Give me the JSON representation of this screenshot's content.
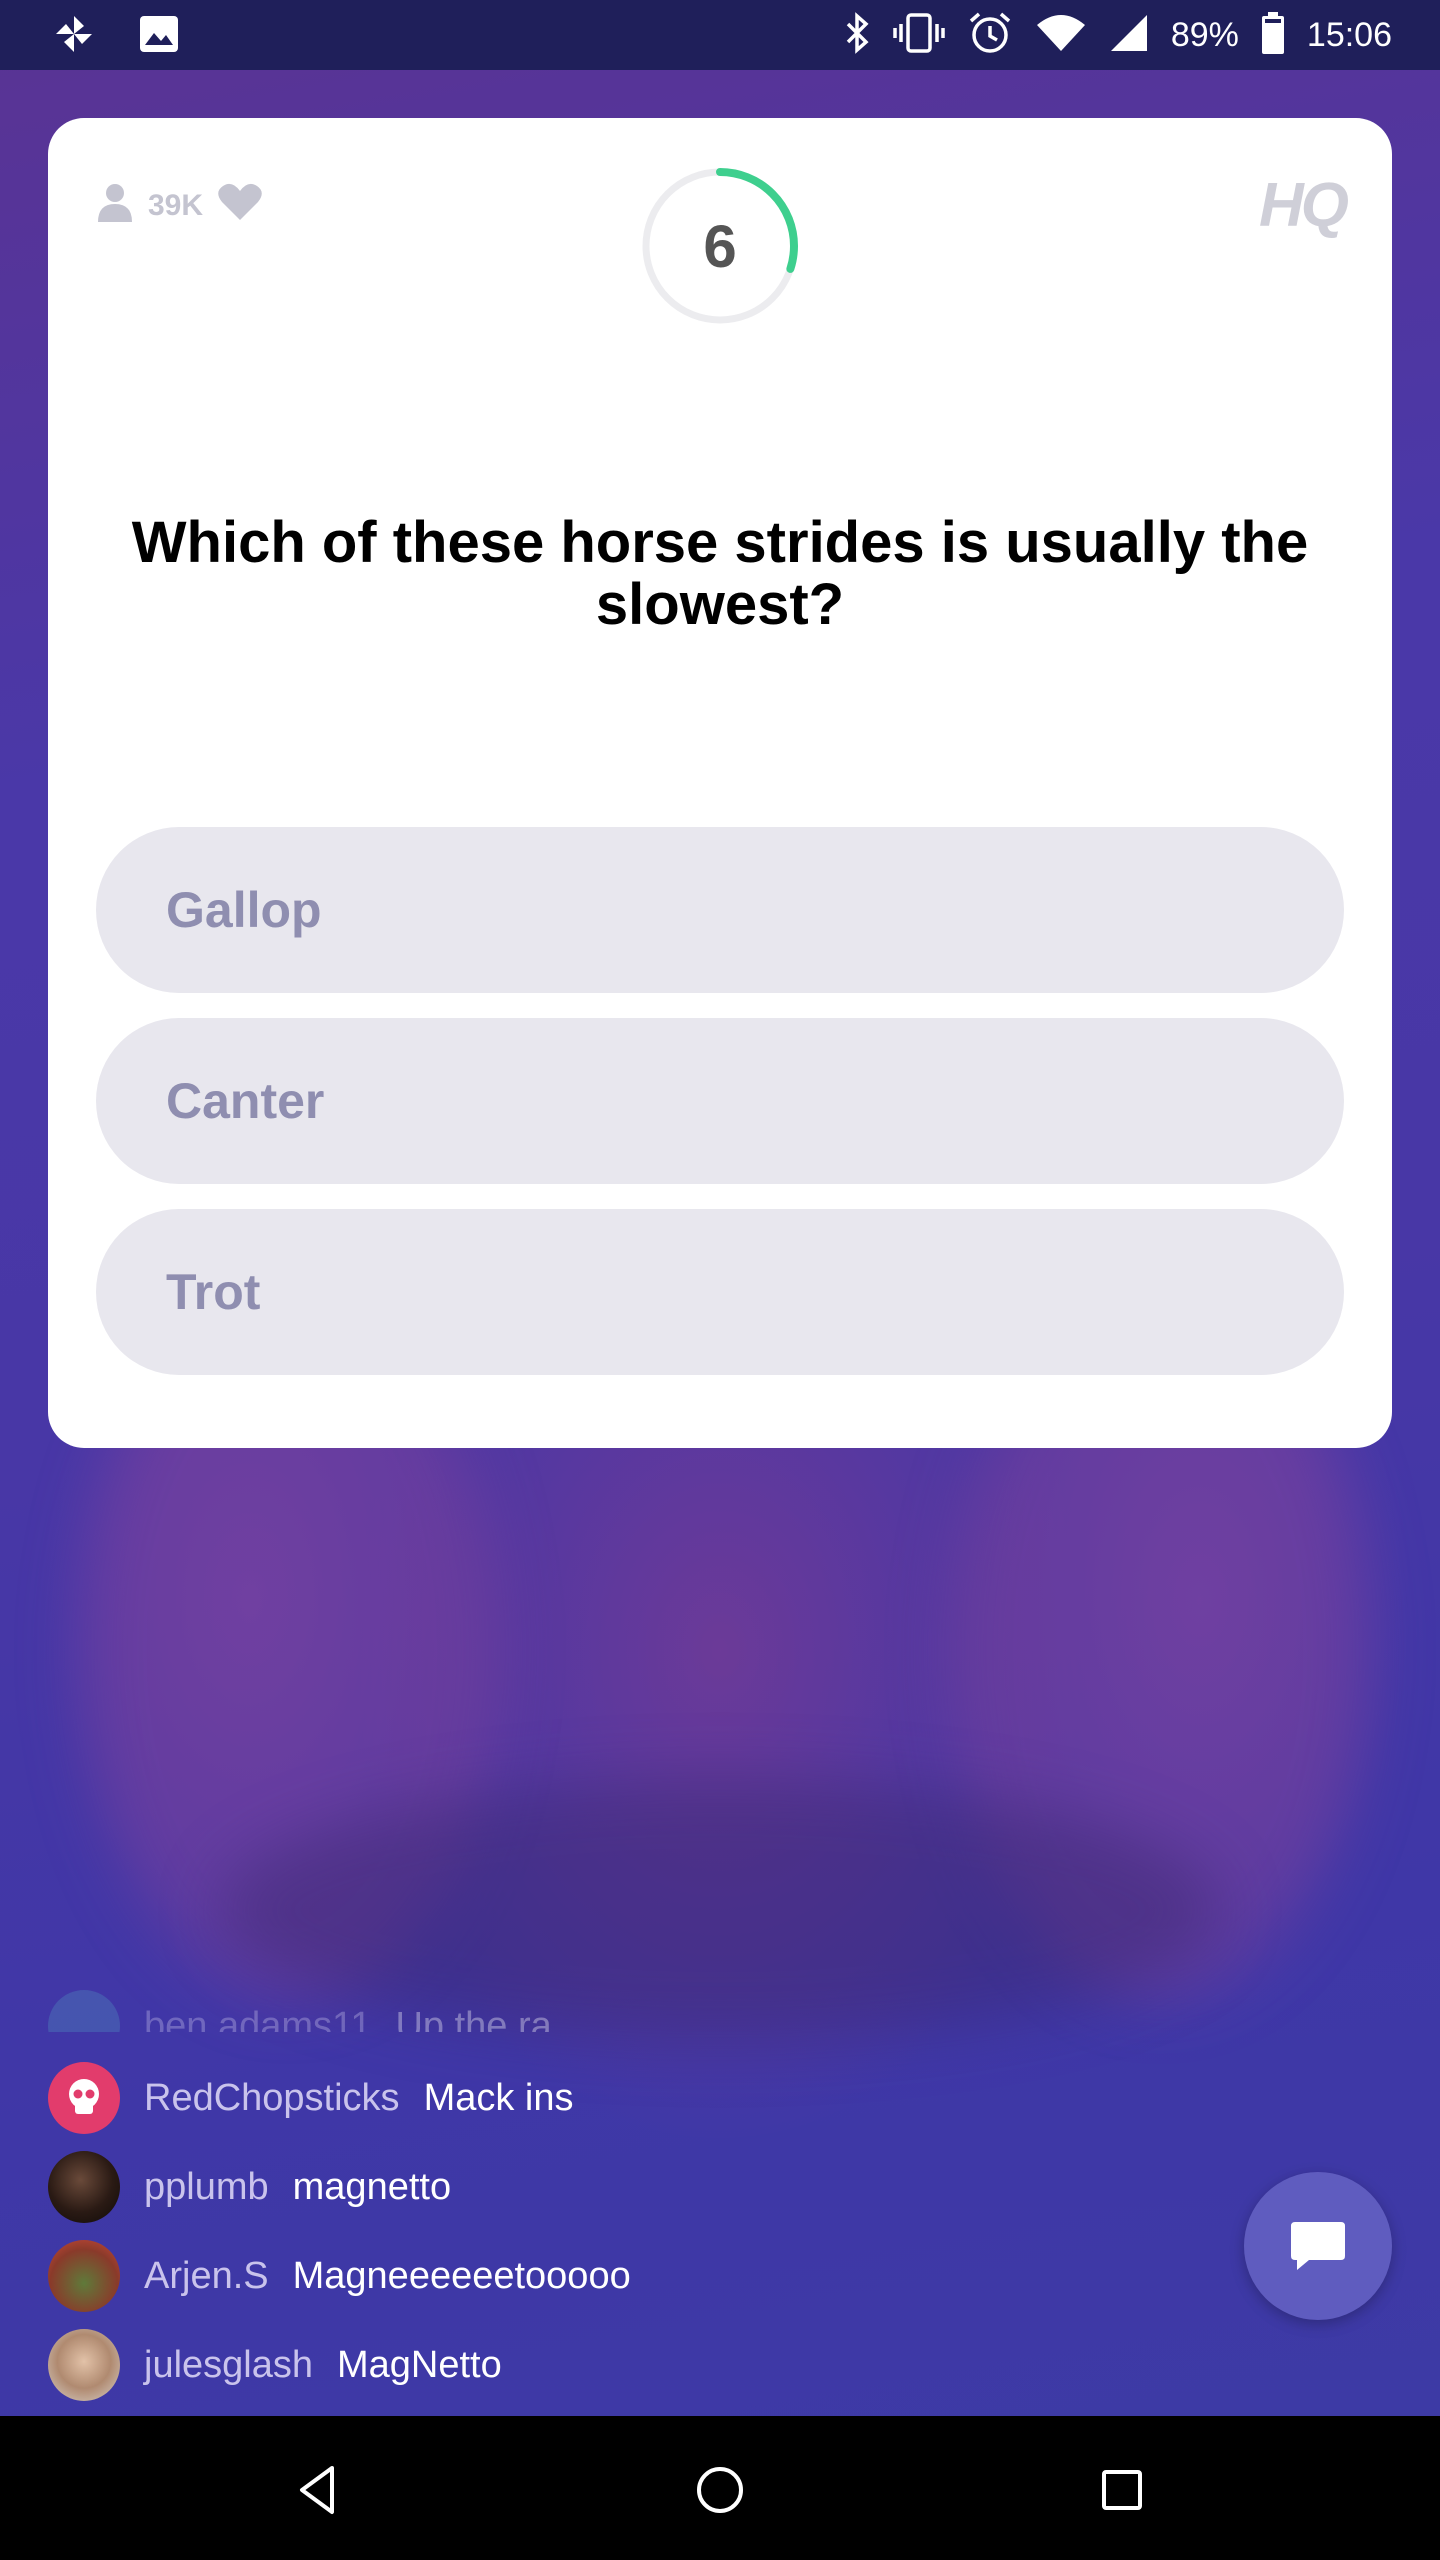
{
  "status_bar": {
    "battery_percent": "89%",
    "time": "15:06",
    "icons_left": [
      "pinwheel-icon",
      "image-icon"
    ],
    "icons_right": [
      "bluetooth-icon",
      "vibrate-icon",
      "alarm-icon",
      "wifi-icon",
      "signal-icon",
      "battery-icon"
    ]
  },
  "card": {
    "viewers": "39K",
    "timer": "6",
    "timer_progress": 0.3,
    "logo": "HQ",
    "question": "Which of these horse strides is usually the slowest?",
    "answers": [
      "Gallop",
      "Canter",
      "Trot"
    ]
  },
  "chat": {
    "messages": [
      {
        "user": "ben adams11",
        "message": "Up the ra"
      },
      {
        "user": "RedChopsticks",
        "message": "Mack ins"
      },
      {
        "user": "pplumb",
        "message": "magnetto"
      },
      {
        "user": "Arjen.S",
        "message": "Magneeeeeetooooo"
      },
      {
        "user": "julesglash",
        "message": "MagNetto"
      }
    ]
  },
  "colors": {
    "accent_green": "#3ecf8e",
    "answer_bg": "#e8e7ee",
    "answer_text": "#8f8eb0",
    "chat_button": "#5f5cbf"
  }
}
